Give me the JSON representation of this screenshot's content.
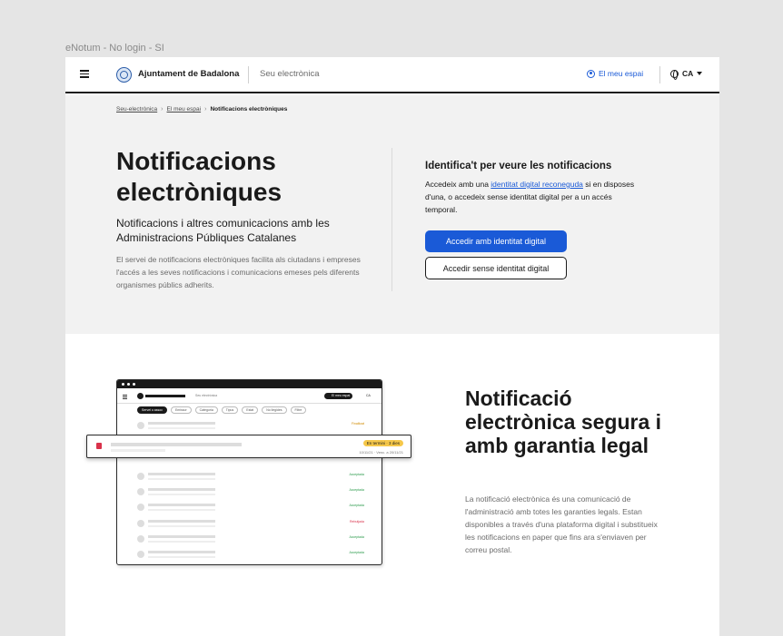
{
  "frame_label": "eNotum - No login - SI",
  "header": {
    "brand": "Ajuntament de Badalona",
    "seu": "Seu electrònica",
    "meu_espai": "El meu espai",
    "lang": "CA"
  },
  "breadcrumb": {
    "item1": "Seu-electrònica",
    "item2": "El meu espai",
    "current": "Notificacions electròniques"
  },
  "hero": {
    "title": "Notificacions electròniques",
    "subtitle": "Notificacions i altres comunicacions amb les Administracions Públiques Catalanes",
    "intro": "El servei de notificacions electròniques facilita als ciutadans i empreses l'accés a les seves notificacions i comunicacions emeses pels diferents organismes públics adherits."
  },
  "identify": {
    "title": "Identifica't per veure les notificacions",
    "text_before": "Accedeix amb una ",
    "link": "identitat digital reconeguda",
    "text_after": " si en disposes d'una, o accedeix sense identitat digital per a un accés temporal.",
    "btn_primary": "Accedir amb identitat digital",
    "btn_secondary": "Accedir sense identitat digital"
  },
  "feature": {
    "title": "Notificació electrònica segura i amb garantia legal",
    "text": "La notificació electrònica és una comunicació de l'administració amb totes les garanties legals. Estan disponibles a través d'una plataforma digital i substitueix les notificacions en paper que fins ara s'enviaven per correu postal."
  },
  "mockup": {
    "seu": "Seu electrònica",
    "meu_espai": "El meu espai",
    "lang": "CA",
    "filters": [
      "Servei o assoc",
      "Emissor",
      "Categoria",
      "Tipus",
      "Estat",
      "No llegides",
      "Filtre"
    ],
    "badge": "En termini · 3 dies",
    "date": "10/11/21 · Venc. a 20/11/21",
    "statuses": [
      "Finalitzat",
      "Acceptada",
      "Acceptada",
      "Acceptada",
      "Rebutjada",
      "Acceptada",
      "Acceptada"
    ]
  },
  "colors": {
    "primary": "#1a5ad7",
    "hero_bg": "#f2f2f2",
    "badge": "#f6c84a"
  }
}
